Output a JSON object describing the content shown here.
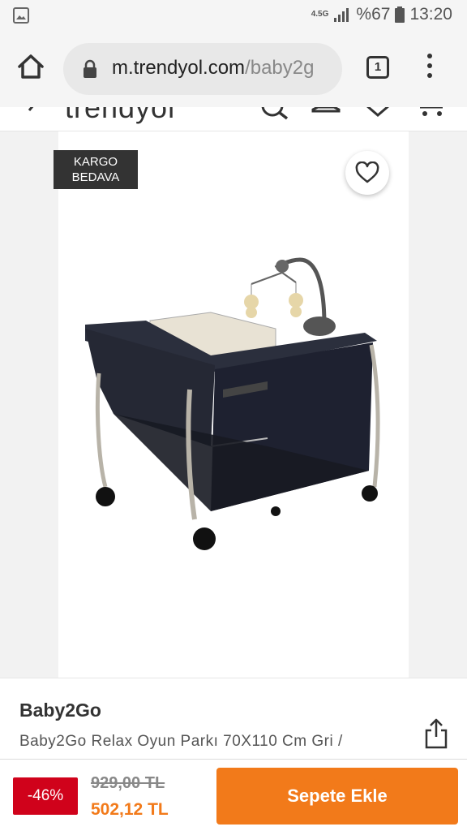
{
  "status_bar": {
    "network_type": "4.5G",
    "battery": "%67",
    "time": "13:20"
  },
  "browser": {
    "url_domain": "m.trendyol.com",
    "url_path": "/baby2g",
    "tab_count": "1"
  },
  "site": {
    "logo": "trendyol"
  },
  "product": {
    "badge_line1": "KARGO",
    "badge_line2": "BEDAVA",
    "brand": "Baby2Go",
    "title": "Baby2Go Relax Oyun Parkı 70X110 Cm Gri /"
  },
  "pricing": {
    "discount": "-46%",
    "old_price": "929,00 TL",
    "new_price": "502,12 TL",
    "add_to_cart_label": "Sepete Ekle"
  },
  "colors": {
    "accent": "#f27a1a",
    "discount": "#d0021b",
    "badge_bg": "#333333"
  }
}
